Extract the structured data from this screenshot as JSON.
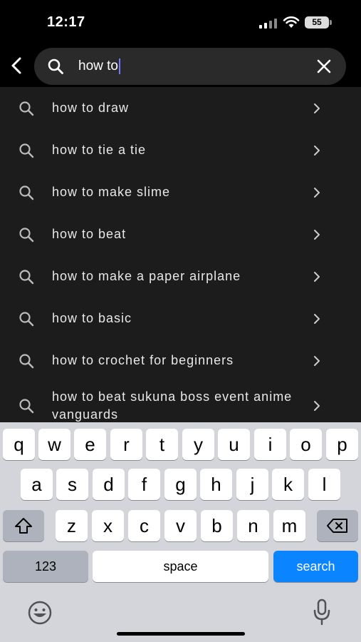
{
  "status": {
    "time": "12:17",
    "battery": "55"
  },
  "search": {
    "query": "how to"
  },
  "suggestions": [
    "how to draw",
    "how to tie a tie",
    "how to make slime",
    "how to beat",
    "how to make a paper airplane",
    "how to basic",
    "how to crochet for beginners",
    "how to beat sukuna boss event anime vanguards"
  ],
  "keyboard": {
    "row1": [
      "q",
      "w",
      "e",
      "r",
      "t",
      "y",
      "u",
      "i",
      "o",
      "p"
    ],
    "row2": [
      "a",
      "s",
      "d",
      "f",
      "g",
      "h",
      "j",
      "k",
      "l"
    ],
    "row3": [
      "z",
      "x",
      "c",
      "v",
      "b",
      "n",
      "m"
    ],
    "numbers_label": "123",
    "space_label": "space",
    "search_label": "search"
  },
  "colors": {
    "accent": "#0a84ff",
    "caret": "#6b7cff",
    "list_bg": "#1c1c1c",
    "keyboard_bg": "#d3d5db"
  },
  "icons": [
    "back-chevron-icon",
    "search-icon",
    "clear-x-icon",
    "chevron-right-icon",
    "shift-icon",
    "backspace-icon",
    "emoji-icon",
    "microphone-icon"
  ]
}
